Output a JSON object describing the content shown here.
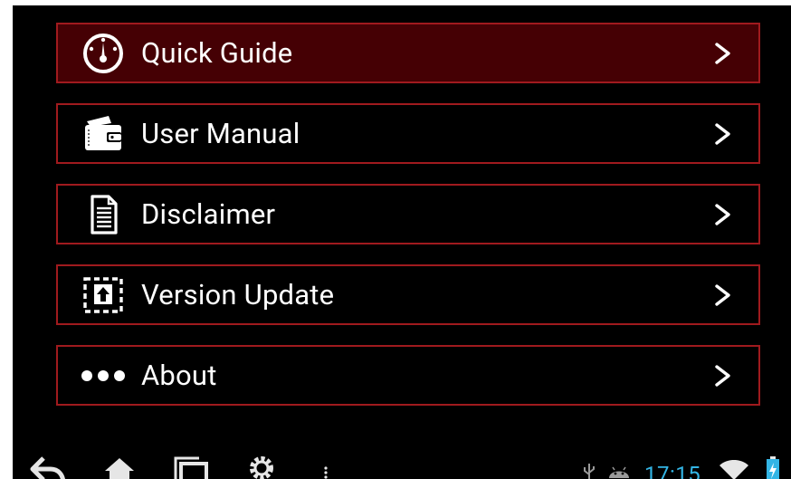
{
  "menu": {
    "items": [
      {
        "label": "Quick Guide",
        "icon": "speedometer-icon"
      },
      {
        "label": "User Manual",
        "icon": "wallet-icon"
      },
      {
        "label": "Disclaimer",
        "icon": "document-icon"
      },
      {
        "label": "Version Update",
        "icon": "upload-icon"
      },
      {
        "label": "About",
        "icon": "more-dots-icon"
      }
    ],
    "active_index": 0
  },
  "system_bar": {
    "time": "17:15",
    "left_icons": [
      "back-icon",
      "home-icon",
      "recent-apps-icon",
      "settings-icon",
      "overflow-menu-icon"
    ],
    "right_icons": [
      "usb-icon",
      "android-debug-icon",
      "wifi-icon",
      "battery-charging-icon"
    ]
  },
  "colors": {
    "accent_border": "#a01a1e",
    "active_bg": "#450004",
    "clock": "#33b5e5"
  }
}
